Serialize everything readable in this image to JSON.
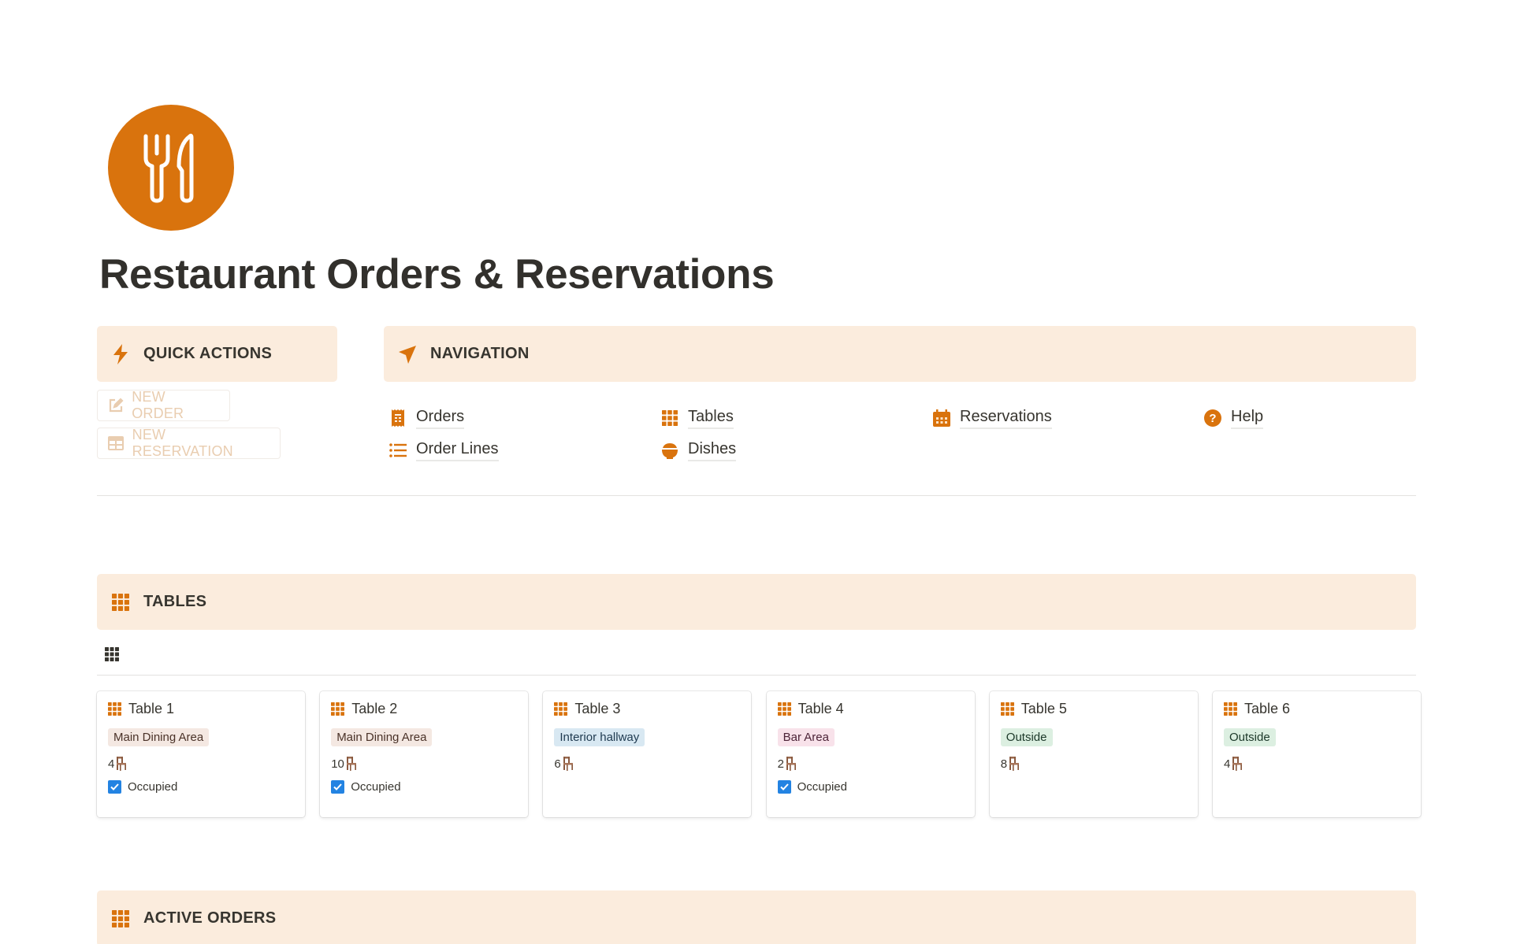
{
  "page": {
    "title": "Restaurant Orders & Reservations",
    "icon": "fork-knife-icon"
  },
  "colors": {
    "accent": "#d9730d",
    "callout_bg": "#fbecdd",
    "checkbox": "#2383e2"
  },
  "quick_actions": {
    "heading": "QUICK ACTIONS",
    "icon": "lightning-icon",
    "buttons": [
      {
        "label": "NEW ORDER",
        "icon": "edit-icon"
      },
      {
        "label": "NEW RESERVATION",
        "icon": "table-icon"
      }
    ]
  },
  "navigation": {
    "heading": "NAVIGATION",
    "icon": "navigation-arrow-icon",
    "links": [
      {
        "label": "Orders",
        "icon": "receipt-icon"
      },
      {
        "label": "Order Lines",
        "icon": "list-icon"
      },
      {
        "label": "Tables",
        "icon": "grid-icon"
      },
      {
        "label": "Dishes",
        "icon": "bowl-icon"
      },
      {
        "label": "Reservations",
        "icon": "calendar-icon"
      },
      {
        "label": "Help",
        "icon": "question-icon"
      }
    ]
  },
  "tables_section": {
    "heading": "TABLES",
    "icon": "grid-icon",
    "view_icon": "gallery-view-icon",
    "cards": [
      {
        "name": "Table 1",
        "area": "Main Dining Area",
        "area_color": "brown",
        "seats": "4",
        "occupied": true,
        "occupied_label": "Occupied"
      },
      {
        "name": "Table 2",
        "area": "Main Dining Area",
        "area_color": "brown",
        "seats": "10",
        "occupied": true,
        "occupied_label": "Occupied"
      },
      {
        "name": "Table 3",
        "area": "Interior hallway",
        "area_color": "blue",
        "seats": "6",
        "occupied": false,
        "occupied_label": ""
      },
      {
        "name": "Table 4",
        "area": "Bar Area",
        "area_color": "pink",
        "seats": "2",
        "occupied": true,
        "occupied_label": "Occupied"
      },
      {
        "name": "Table 5",
        "area": "Outside",
        "area_color": "green",
        "seats": "8",
        "occupied": false,
        "occupied_label": ""
      },
      {
        "name": "Table 6",
        "area": "Outside",
        "area_color": "green",
        "seats": "4",
        "occupied": false,
        "occupied_label": ""
      }
    ]
  },
  "active_orders_section": {
    "heading": "ACTIVE ORDERS",
    "icon": "grid-icon"
  }
}
